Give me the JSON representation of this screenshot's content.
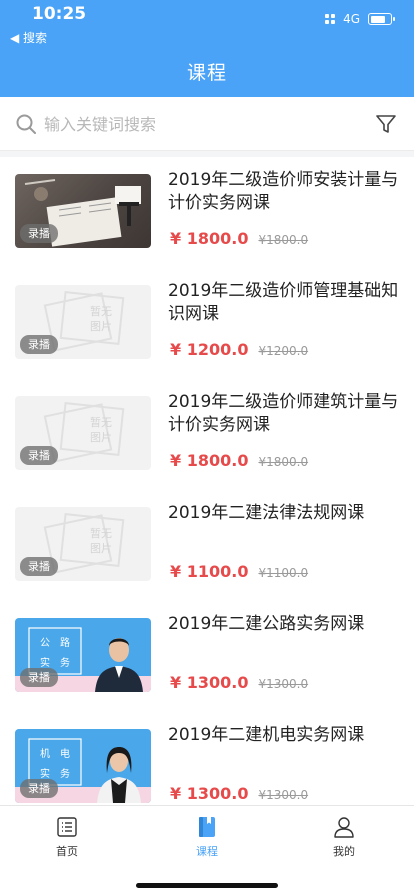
{
  "status_bar": {
    "time": "10:25",
    "back_label": "◀ 搜索",
    "network": "4G",
    "battery_level": 0.75
  },
  "header": {
    "title": "课程"
  },
  "search": {
    "placeholder": "输入关键词搜索",
    "value": ""
  },
  "placeholder_image_text": [
    "暂无",
    "图片"
  ],
  "courses": [
    {
      "title": "2019年二级造价师安装计量与计价实务网课",
      "price": "¥ 1800.0",
      "old_price": "¥1800.0",
      "badge": "录播",
      "thumb": "photo"
    },
    {
      "title": "2019年二级造价师管理基础知识网课",
      "price": "¥ 1200.0",
      "old_price": "¥1200.0",
      "badge": "录播",
      "thumb": "placeholder"
    },
    {
      "title": "2019年二级造价师建筑计量与计价实务网课",
      "price": "¥ 1800.0",
      "old_price": "¥1800.0",
      "badge": "录播",
      "thumb": "placeholder"
    },
    {
      "title": "2019年二建法律法规网课",
      "price": "¥ 1100.0",
      "old_price": "¥1100.0",
      "badge": "录播",
      "thumb": "placeholder"
    },
    {
      "title": "2019年二建公路实务网课",
      "price": "¥ 1300.0",
      "old_price": "¥1300.0",
      "badge": "录播",
      "thumb": "teacher-male",
      "thumb_text": [
        "公",
        "路",
        "实",
        "务"
      ]
    },
    {
      "title": "2019年二建机电实务网课",
      "price": "¥ 1300.0",
      "old_price": "¥1300.0",
      "badge": "录播",
      "thumb": "teacher-female",
      "thumb_text": [
        "机",
        "电",
        "实",
        "务"
      ]
    }
  ],
  "tabbar": {
    "items": [
      {
        "label": "首页",
        "icon": "list-icon"
      },
      {
        "label": "课程",
        "icon": "book-icon",
        "active": true
      },
      {
        "label": "我的",
        "icon": "user-icon"
      }
    ]
  },
  "colors": {
    "primary": "#4aa3f7",
    "price": "#e64a4a",
    "muted": "#9a9a9a"
  }
}
